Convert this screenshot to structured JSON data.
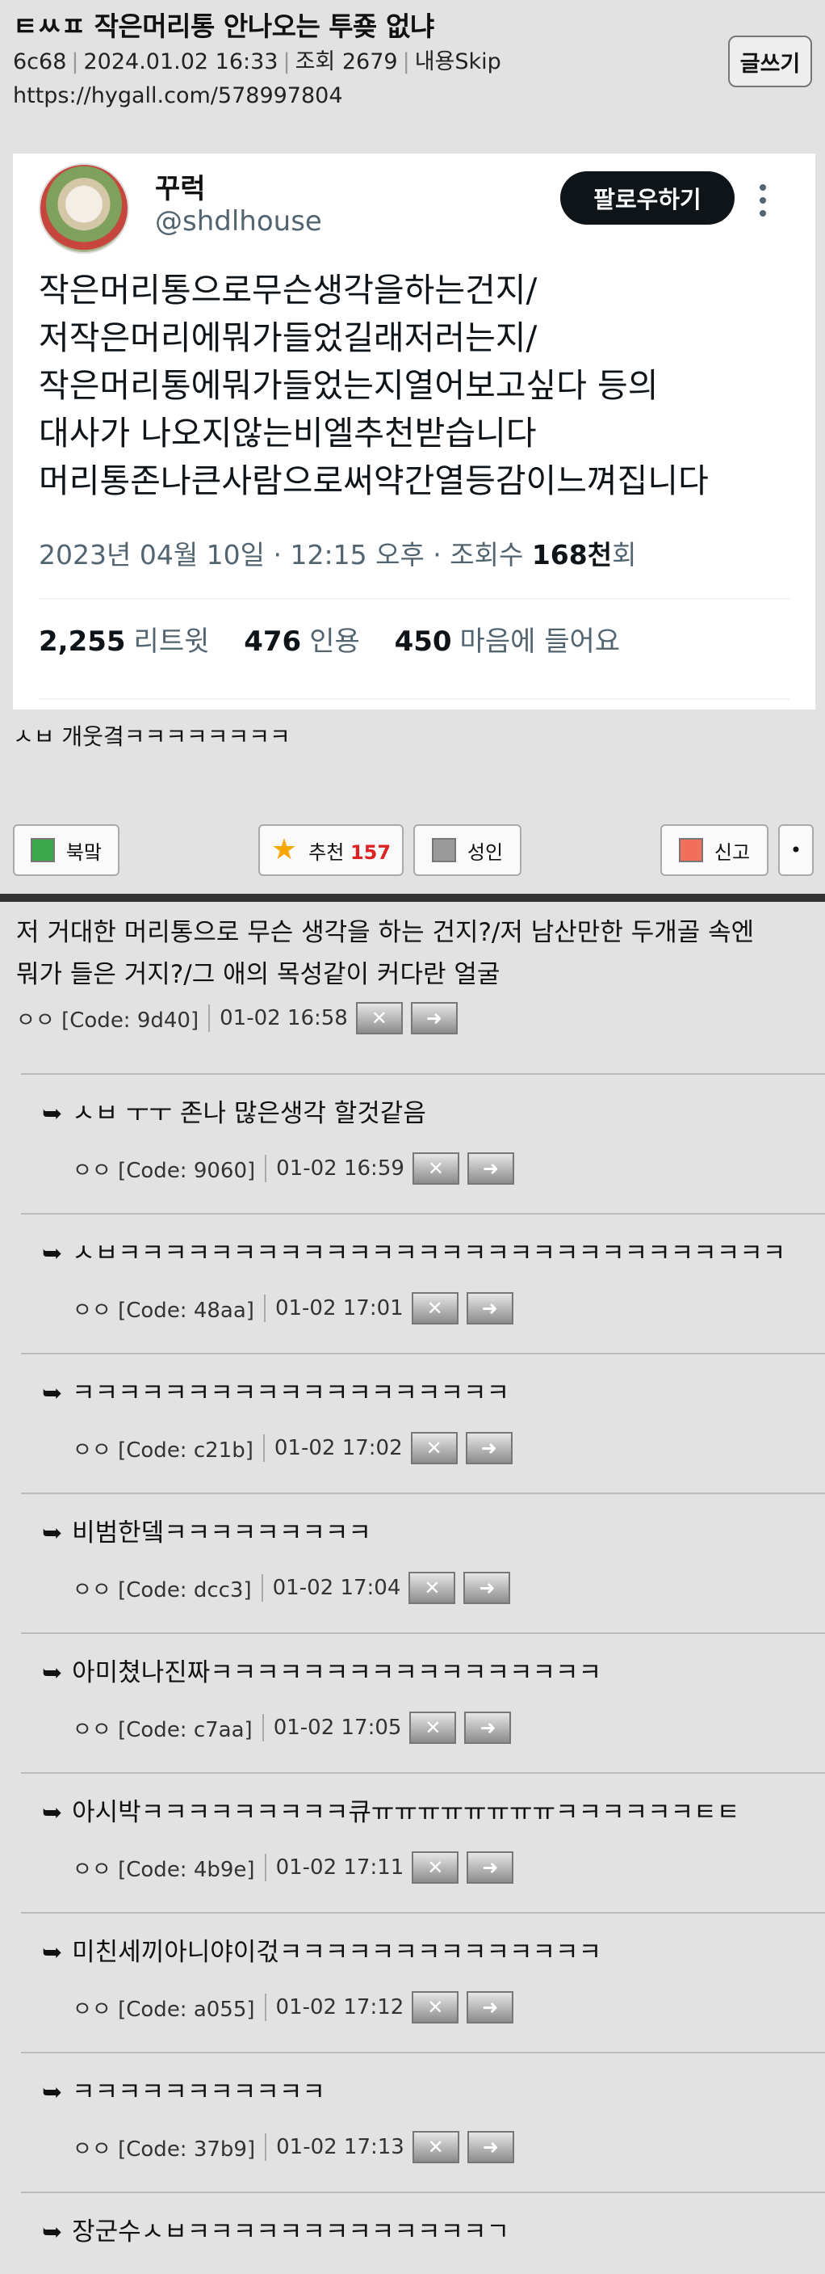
{
  "header": {
    "title": "ㅌㅆㅍ 작은머리통 안나오는 투죶 없냐",
    "meta": [
      "6c68",
      "2024.01.02 16:33",
      "조회 2679",
      "내용Skip"
    ],
    "url": "https://hygall.com/578997804",
    "write_label": "글쓰기"
  },
  "tweet": {
    "name": "꾸럭",
    "handle": "@shdlhouse",
    "follow_label": "팔로우하기",
    "body_lines": [
      "작은머리통으로무슨생각을하는건지/",
      "저작은머리에뭐가들었길래저러는지/",
      "작은머리통에뭐가들었는지열어보고싶다 등의",
      "대사가 나오지않는비엘추천받습니다",
      "머리통존나큰사람으로써약간열등감이느껴집니다"
    ],
    "time_prefix": "2023년 04월 10일 · 12:15 오후 · 조회수 ",
    "views": "168천",
    "views_suffix": "회",
    "stats": [
      {
        "num": "2,255",
        "label": "리트윗"
      },
      {
        "num": "476",
        "label": "인용"
      },
      {
        "num": "450",
        "label": "마음에 들어요"
      }
    ]
  },
  "post_text": "ㅅㅂ 개웃곀ㅋㅋㅋㅋㅋㅋㅋㅋ",
  "buttons": {
    "bookmark": "북맠",
    "recommend": "추천",
    "recommend_count": "157",
    "adult": "성인",
    "report": "신고",
    "more": "•"
  },
  "mini_buttons": {
    "delete": "✕",
    "reply": "➜"
  },
  "colors": {
    "bookmark": "#3aa84a",
    "adult": "#9a9a9a",
    "report": "#f26f5c",
    "star": "#f6a700",
    "count": "#dd2222"
  },
  "main_comment": {
    "text_lines": [
      "저 거대한 머리통으로 무슨 생각을 하는 건지?/저 남산만한 두개골 속엔",
      "뭐가 들은 거지?/그 애의 목성같이 커다란 얼굴"
    ],
    "author": "ㅇㅇ [Code: 9d40]",
    "time": "01-02 16:58"
  },
  "replies": [
    {
      "text": "ㅅㅂ ㅜㅜ 존나 많은생각 할것같음",
      "author": "ㅇㅇ [Code: 9060]",
      "time": "01-02 16:59"
    },
    {
      "text": "ㅅㅂㅋㅋㅋㅋㅋㅋㅋㅋㅋㅋㅋㅋㅋㅋㅋㅋㅋㅋㅋㅋㅋㅋㅋㅋㅋㅋㅋㅋㅋ",
      "author": "ㅇㅇ [Code: 48aa]",
      "time": "01-02 17:01"
    },
    {
      "text": "ㅋㅋㅋㅋㅋㅋㅋㅋㅋㅋㅋㅋㅋㅋㅋㅋㅋㅋㅋ",
      "author": "ㅇㅇ [Code: c21b]",
      "time": "01-02 17:02"
    },
    {
      "text": "비범한뎈ㅋㅋㅋㅋㅋㅋㅋㅋㅋ",
      "author": "ㅇㅇ [Code: dcc3]",
      "time": "01-02 17:04"
    },
    {
      "text": "아미쳤나진짜ㅋㅋㅋㅋㅋㅋㅋㅋㅋㅋㅋㅋㅋㅋㅋㅋㅋ",
      "author": "ㅇㅇ [Code: c7aa]",
      "time": "01-02 17:05"
    },
    {
      "text": "아시박ㅋㅋㅋㅋㅋㅋㅋㅋㅋ큐ㅠㅠㅠㅠㅠㅠㅠㅠㅋㅋㅋㅋㅋㅋㅌㅌ",
      "author": "ㅇㅇ [Code: 4b9e]",
      "time": "01-02 17:11"
    },
    {
      "text": "미친세끼아니야이걳ㅋㅋㅋㅋㅋㅋㅋㅋㅋㅋㅋㅋㅋㅋ",
      "author": "ㅇㅇ [Code: a055]",
      "time": "01-02 17:12"
    },
    {
      "text": "ㅋㅋㅋㅋㅋㅋㅋㅋㅋㅋㅋ",
      "author": "ㅇㅇ [Code: 37b9]",
      "time": "01-02 17:13"
    },
    {
      "text": "장군수ㅅㅂㅋㅋㅋㅋㅋㅋㅋㅋㅋㅋㅋㅋㅋㄱ",
      "author": "",
      "time": ""
    }
  ]
}
